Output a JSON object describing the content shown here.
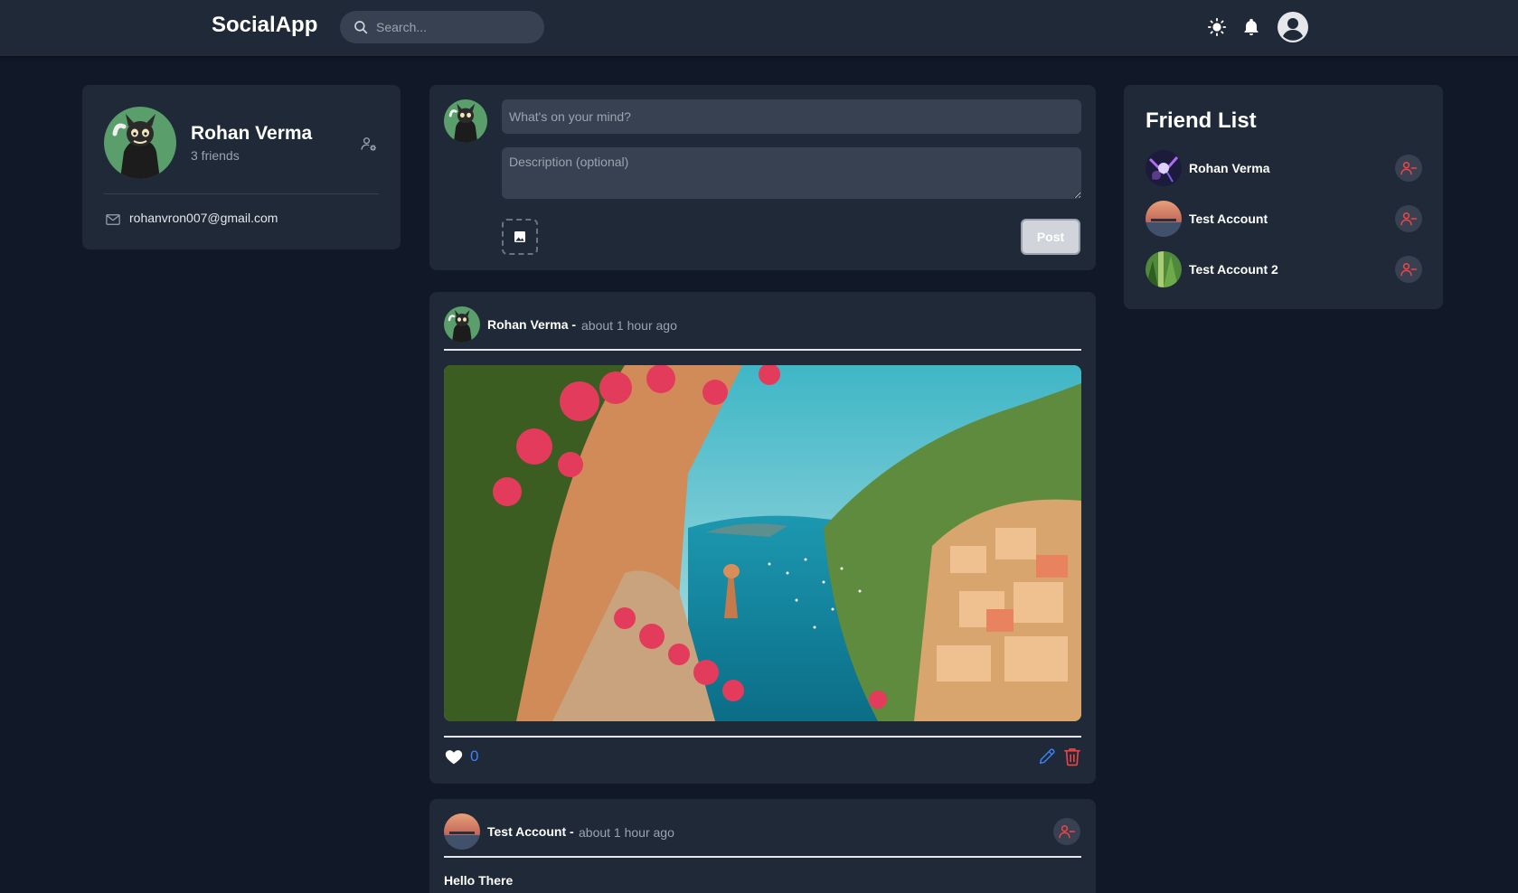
{
  "app": {
    "brand": "SocialApp"
  },
  "header": {
    "search_placeholder": "Search...",
    "icons": [
      "sun-icon",
      "bell-icon",
      "user-avatar-icon"
    ]
  },
  "profile": {
    "name": "Rohan Verma",
    "friends": "3 friends",
    "email": "rohanvron007@gmail.com"
  },
  "composer": {
    "title_placeholder": "What's on your mind?",
    "description_placeholder": "Description (optional)",
    "post_label": "Post"
  },
  "posts": [
    {
      "author": "Rohan Verma -",
      "time": "about 1 hour ago",
      "likes": "0",
      "image": "coastal-village-photo"
    },
    {
      "author": "Test Account -",
      "time": "about 1 hour ago",
      "title": "Hello There"
    }
  ],
  "friend_list": {
    "title": "Friend List",
    "items": [
      {
        "name": "Rohan Verma"
      },
      {
        "name": "Test Account"
      },
      {
        "name": "Test Account 2"
      }
    ]
  },
  "colors": {
    "background": "#111827",
    "surface": "#1f2937",
    "input": "#374151",
    "accent_blue": "#3b82f6",
    "danger_red": "#ef4444"
  }
}
